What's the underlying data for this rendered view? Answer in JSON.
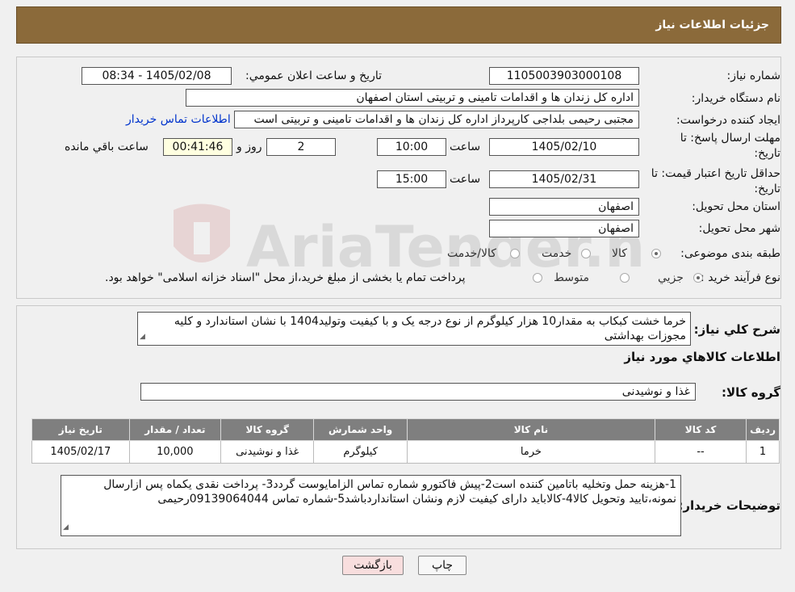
{
  "header": {
    "title": "جزئیات اطلاعات نیاز"
  },
  "form": {
    "need_number_label": "شماره نیاز:",
    "need_number": "1105003903000108",
    "announce_label": "تاریخ و ساعت اعلان عمومي:",
    "announce_value": "1405/02/08 - 08:34",
    "buyer_org_label": "نام دستگاه خريدار:",
    "buyer_org": "اداره کل زندان ها و اقدامات تامینی و تربیتی استان اصفهان",
    "creator_label": "ايجاد کننده درخواست:",
    "creator": "مجتبی رحیمی بلداجی کارپرداز اداره کل زندان ها و اقدامات تامینی و تربیتی است",
    "contact_link": "اطلاعات تماس خريدار",
    "deadline_label_1": "مهلت ارسال پاسخ: تا",
    "deadline_label_2": "تاريخ:",
    "deadline_date": "1405/02/10",
    "time_label": "ساعت",
    "deadline_time": "10:00",
    "days_value": "2",
    "days_label": "روز و",
    "remaining_value": "00:41:46",
    "remaining_label": "ساعت باقي مانده",
    "validity_label_1": "حداقل تاريخ اعتبار قيمت: تا",
    "validity_label_2": "تاريخ:",
    "validity_date": "1405/02/31",
    "validity_time": "15:00",
    "province_label": "استان محل تحويل:",
    "province": "اصفهان",
    "city_label": "شهر محل تحويل:",
    "city": "اصفهان",
    "category_label": "طبقه بندی موضوعی:",
    "category_options": [
      "کالا",
      "خدمت",
      "کالا/خدمت"
    ],
    "category_selected": 0,
    "process_label": "نوع فرآيند خريد :",
    "process_options": [
      "جزيي",
      "متوسط"
    ],
    "process_selected": 0,
    "process_note": "پرداخت تمام يا بخشی از مبلغ خريد،از محل \"اسناد خزانه اسلامی\" خواهد بود."
  },
  "summary": {
    "desc_label": "شرح کلي نياز:",
    "desc_text": "خرما خشت کبکاب به مقدار10 هزار کیلوگرم  از نوع درجه یک و با کیفیت وتولید1404 با نشان استاندارد و کلیه مجوزات بهداشتی",
    "goods_info_title": "اطلاعات کالاهاي مورد نياز",
    "group_label": "گروه کالا:",
    "group_value": "غذا و نوشیدنی",
    "table_headers": [
      "رديف",
      "کد کالا",
      "نام کالا",
      "واحد شمارش",
      "گروه کالا",
      "تعداد / مقدار",
      "تاريخ نياز"
    ],
    "rows": [
      [
        "1",
        "--",
        "خرما",
        "کیلوگرم",
        "غذا و نوشیدنی",
        "10,000",
        "1405/02/17"
      ]
    ],
    "buyer_notes_label": "توضيحات خريدار:",
    "buyer_notes": "1-هزینه حمل وتخلیه باتامین کننده است2-پیش فاکتورو شماره تماس الزامایوست گردد3- پرداخت نقدی یکماه  پس ازارسال نمونه،تایید وتحویل کالا4-کالاباید دارای کیفیت لازم ونشان استانداردباشد5-شماره تماس 09139064044رحیمی"
  },
  "buttons": {
    "print": "چاپ",
    "back": "بازگشت"
  },
  "watermark": {
    "text": "AriaTender.neT"
  },
  "colors": {
    "header_bg": "#8b6a3a",
    "link": "#0033cc",
    "back_btn_bg": "#f8dede"
  }
}
